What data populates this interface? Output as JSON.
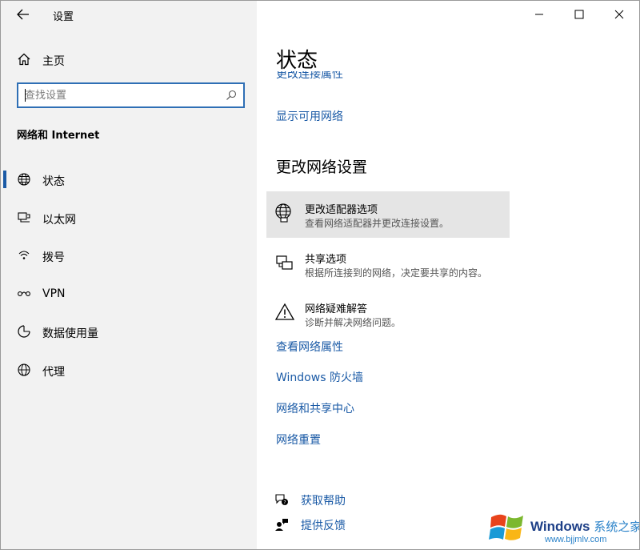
{
  "app": {
    "title": "设置"
  },
  "sidebar": {
    "home_label": "主页",
    "search_placeholder": "查找设置",
    "section_title": "网络和 Internet",
    "items": [
      {
        "label": "状态",
        "icon": "globe-icon",
        "active": true
      },
      {
        "label": "以太网",
        "icon": "ethernet-icon"
      },
      {
        "label": "拨号",
        "icon": "dialup-icon"
      },
      {
        "label": "VPN",
        "icon": "vpn-icon"
      },
      {
        "label": "数据使用量",
        "icon": "data-usage-icon"
      },
      {
        "label": "代理",
        "icon": "globe-icon"
      }
    ]
  },
  "main": {
    "title": "状态",
    "clipped_link": "更改连接属性",
    "show_networks_link": "显示可用网络",
    "change_settings_title": "更改网络设置",
    "options": [
      {
        "title": "更改适配器选项",
        "desc": "查看网络适配器并更改连接设置。",
        "icon": "adapter-globe-icon"
      },
      {
        "title": "共享选项",
        "desc": "根据所连接到的网络，决定要共享的内容。",
        "icon": "sharing-icon"
      },
      {
        "title": "网络疑难解答",
        "desc": "诊断并解决网络问题。",
        "icon": "warning-icon"
      }
    ],
    "links": [
      "查看网络属性",
      "Windows 防火墙",
      "网络和共享中心",
      "网络重置"
    ],
    "help": {
      "get_help": "获取帮助",
      "feedback": "提供反馈"
    }
  },
  "watermark": {
    "brand": "Windows",
    "brand_cn": "系统之家",
    "url": "www.bjjmlv.com"
  },
  "colors": {
    "accent": "#1a5aa6",
    "sidebar_bg": "#f2f2f2",
    "hover_bg": "#e5e5e5"
  }
}
